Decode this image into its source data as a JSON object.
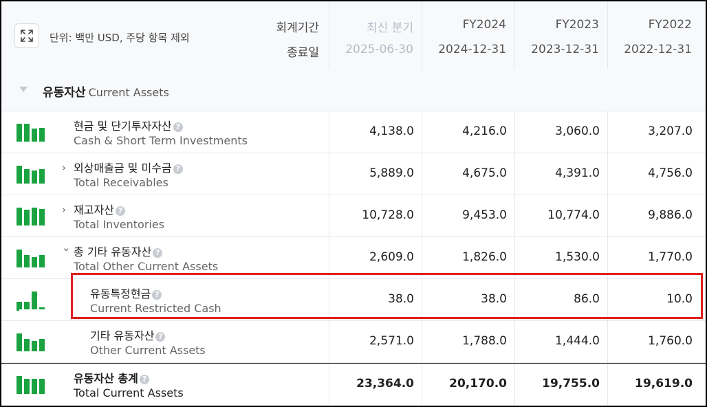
{
  "header": {
    "unit_label": "단위: 백만 USD, 주당 항목 제외",
    "period_label": "회계기간",
    "end_date_label": "종료일",
    "expand_icon": "expand-icon",
    "columns": [
      {
        "period": "최신 분기",
        "date": "2025-06-30"
      },
      {
        "period": "FY2024",
        "date": "2024-12-31"
      },
      {
        "period": "FY2023",
        "date": "2023-12-31"
      },
      {
        "period": "FY2022",
        "date": "2022-12-31"
      }
    ]
  },
  "section": {
    "title_ko": "유동자산",
    "title_en": "Current Assets",
    "toggle_icon": "triangle-down-icon"
  },
  "rows": [
    {
      "ko": "현금 및 단기투자자산",
      "en": "Cash & Short Term Investments",
      "expander": "",
      "values": [
        "4,138.0",
        "4,216.0",
        "3,060.0",
        "3,207.0"
      ],
      "trend": [
        4138,
        4216,
        3060,
        3207
      ]
    },
    {
      "ko": "외상매출금 및 미수금",
      "en": "Total Receivables",
      "expander": "›",
      "values": [
        "5,889.0",
        "4,675.0",
        "4,391.0",
        "4,756.0"
      ],
      "trend": [
        5889,
        4675,
        4391,
        4756
      ]
    },
    {
      "ko": "재고자산",
      "en": "Total Inventories",
      "expander": "›",
      "values": [
        "10,728.0",
        "9,453.0",
        "10,774.0",
        "9,886.0"
      ],
      "trend": [
        10728,
        9453,
        10774,
        9886
      ]
    },
    {
      "ko": "총 기타 유동자산",
      "en": "Total Other Current Assets",
      "expander": "⌄",
      "values": [
        "2,609.0",
        "1,826.0",
        "1,530.0",
        "1,770.0"
      ],
      "trend": [
        2609,
        1826,
        1530,
        1770
      ]
    },
    {
      "ko": "유동특정현금",
      "en": "Current Restricted Cash",
      "expander": "",
      "values": [
        "38.0",
        "38.0",
        "86.0",
        "10.0"
      ],
      "trend": [
        38,
        38,
        86,
        10
      ]
    },
    {
      "ko": "기타 유동자산",
      "en": "Other Current Assets",
      "expander": "",
      "values": [
        "2,571.0",
        "1,788.0",
        "1,444.0",
        "1,760.0"
      ],
      "trend": [
        2571,
        1788,
        1444,
        1760
      ]
    },
    {
      "ko": "유동자산 총계",
      "en": "Total Current Assets",
      "expander": "",
      "values": [
        "23,364.0",
        "20,170.0",
        "19,755.0",
        "19,619.0"
      ],
      "trend": [
        23364,
        20170,
        19755,
        19619
      ]
    }
  ],
  "help_glyph": "?",
  "colors": {
    "spark": "#1aa340",
    "highlight": "#e02020"
  }
}
